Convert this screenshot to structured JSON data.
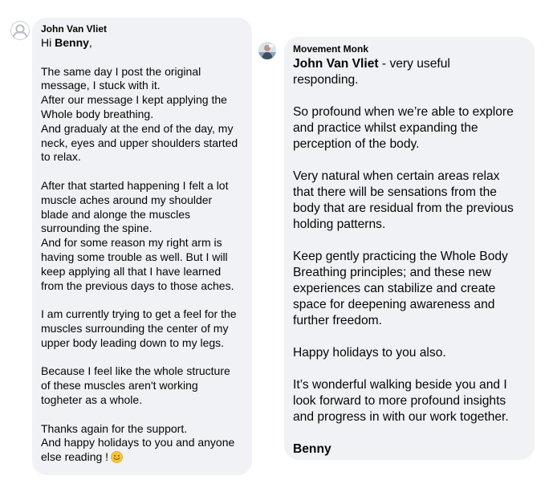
{
  "messages": [
    {
      "sender": "John Van Vliet",
      "avatar_icon": "default-user-silhouette-icon",
      "greeting_prefix": "Hi ",
      "greeting_name": "Benny",
      "greeting_suffix": ",",
      "paragraphs": [
        "The same day I post the original\nmessage, I stuck with it.\nAfter our message I kept applying the\nWhole body breathing.\nAnd gradualy at the end of the day, my\nneck, eyes and upper shoulders started\nto relax.",
        "After that started happening I felt a lot\nmuscle aches around my shoulder\nblade and alonge the muscles\nsurrounding the spine.\nAnd for some reason my right arm is\nhaving some trouble as well. But I will\nkeep applying all that I have learned\nfrom the previous days to those aches.",
        "I am currently trying to get a feel for the\nmuscles surrounding the center of my\nupper body leading down to my legs.",
        "Because I feel like the whole structure\nof these muscles aren't working\ntogheter as a whole."
      ],
      "closing": "Thanks again for the support.\nAnd happy holidays to you and anyone\nelse reading !",
      "emoji_icon": "smiling-face-emoji-icon"
    },
    {
      "sender": "Movement Monk",
      "avatar_icon": "profile-photo-avatar-icon",
      "mention": "John Van Vliet",
      "mention_suffix": " - very useful\nresponding.",
      "paragraphs": [
        "So profound when we’re able to explore\nand practice whilst expanding the\nperception of the body.",
        "Very natural when certain areas relax\nthat there will be sensations from the\nbody that are residual from the previous\nholding patterns.",
        "Keep gently practicing the Whole Body\nBreathing principles; and these new\nexperiences can stabilize and create\nspace for deepening awareness and\nfurther freedom.",
        "Happy holidays to you also.",
        "It’s wonderful walking beside you and I\nlook forward to more profound insights\nand progress in with our work together."
      ],
      "signature": "Benny"
    }
  ],
  "colors": {
    "bubble_background": "#f0f2f5",
    "text": "#050505",
    "page_background": "#ffffff"
  }
}
